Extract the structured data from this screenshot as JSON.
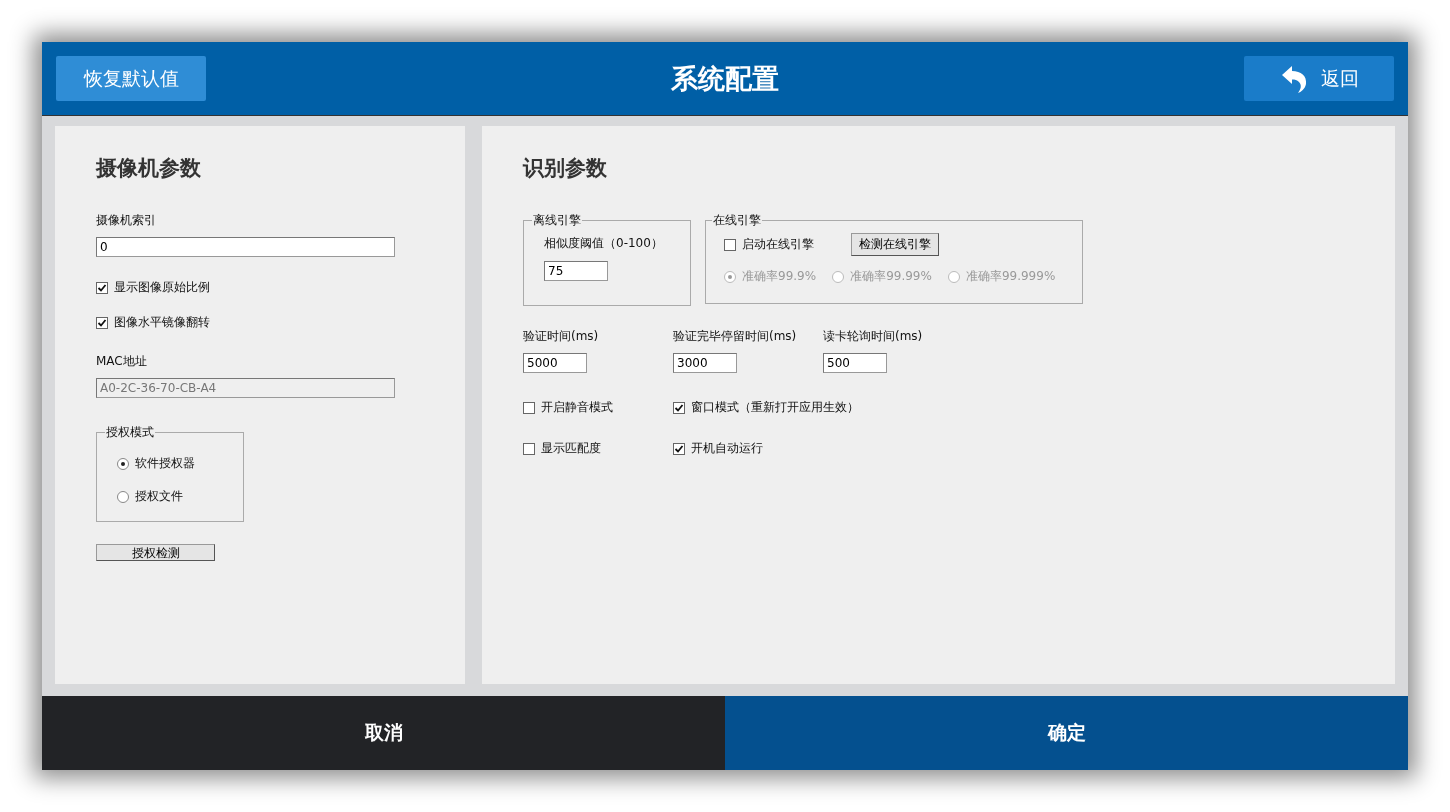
{
  "header": {
    "reset_button": "恢复默认值",
    "title": "系统配置",
    "back_button": "返回"
  },
  "camera_panel": {
    "title": "摄像机参数",
    "index_label": "摄像机索引",
    "index_value": "0",
    "options": [
      {
        "label": "显示图像原始比例",
        "checked": true
      },
      {
        "label": "图像水平镜像翻转",
        "checked": true
      }
    ],
    "mac_label": "MAC地址",
    "mac_value": "A0-2C-36-70-CB-A4",
    "auth_group": {
      "legend": "授权模式",
      "options": [
        {
          "label": "软件授权器",
          "selected": true
        },
        {
          "label": "授权文件",
          "selected": false
        }
      ]
    },
    "check_button": "授权检测"
  },
  "recognition_panel": {
    "title": "识别参数",
    "offline_group": {
      "legend": "离线引擎",
      "threshold_label": "相似度阈值（0-100）",
      "threshold_value": "75"
    },
    "online_group": {
      "legend": "在线引擎",
      "enable": {
        "label": "启动在线引擎",
        "checked": false
      },
      "detect_button": "检测在线引擎",
      "accuracy_options": [
        {
          "label": "准确率99.9%",
          "selected": true,
          "disabled": true
        },
        {
          "label": "准确率99.99%",
          "selected": false,
          "disabled": true
        },
        {
          "label": "准确率99.999%",
          "selected": false,
          "disabled": true
        }
      ]
    },
    "timings": [
      {
        "label": "验证时间(ms)",
        "value": "5000"
      },
      {
        "label": "验证完毕停留时间(ms)",
        "value": "3000"
      },
      {
        "label": "读卡轮询时间(ms)",
        "value": "500"
      }
    ],
    "options": [
      {
        "label": "开启静音模式",
        "checked": false
      },
      {
        "label": "窗口模式（重新打开应用生效）",
        "checked": true
      },
      {
        "label": "显示匹配度",
        "checked": false
      },
      {
        "label": "开机自动运行",
        "checked": true
      }
    ]
  },
  "footer": {
    "cancel_button": "取消",
    "confirm_button": "确定"
  }
}
